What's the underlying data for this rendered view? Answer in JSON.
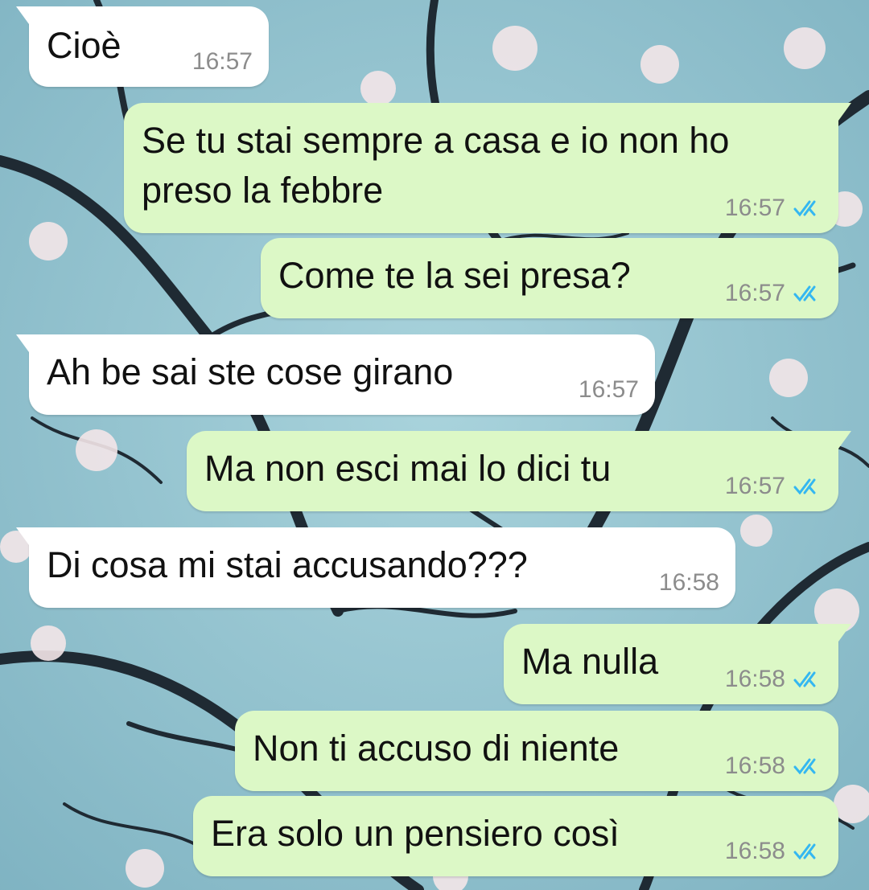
{
  "colors": {
    "incoming_bubble": "#ffffff",
    "outgoing_bubble": "#dcf8c6",
    "read_tick": "#34b7f1",
    "timestamp": "#8c8c8c"
  },
  "messages": [
    {
      "text": "Cioè",
      "time": "16:57",
      "direction": "incoming",
      "status_icon": ""
    },
    {
      "text": "Se tu stai sempre a casa e io non ho",
      "text2": "preso la febbre",
      "time": "16:57",
      "direction": "outgoing",
      "status_icon": "double-check-read"
    },
    {
      "text": "Come te la sei presa?",
      "time": "16:57",
      "direction": "outgoing",
      "status_icon": "double-check-read"
    },
    {
      "text": "Ah be sai ste cose girano",
      "time": "16:57",
      "direction": "incoming",
      "status_icon": ""
    },
    {
      "text": "Ma non esci mai lo dici tu",
      "time": "16:57",
      "direction": "outgoing",
      "status_icon": "double-check-read"
    },
    {
      "text": "Di cosa mi stai accusando???",
      "time": "16:58",
      "direction": "incoming",
      "status_icon": ""
    },
    {
      "text": "Ma nulla",
      "time": "16:58",
      "direction": "outgoing",
      "status_icon": "double-check-read"
    },
    {
      "text": "Non ti accuso di niente",
      "time": "16:58",
      "direction": "outgoing",
      "status_icon": "double-check-read"
    },
    {
      "text": "Era solo un pensiero così",
      "time": "16:58",
      "direction": "outgoing",
      "status_icon": "double-check-read"
    }
  ]
}
